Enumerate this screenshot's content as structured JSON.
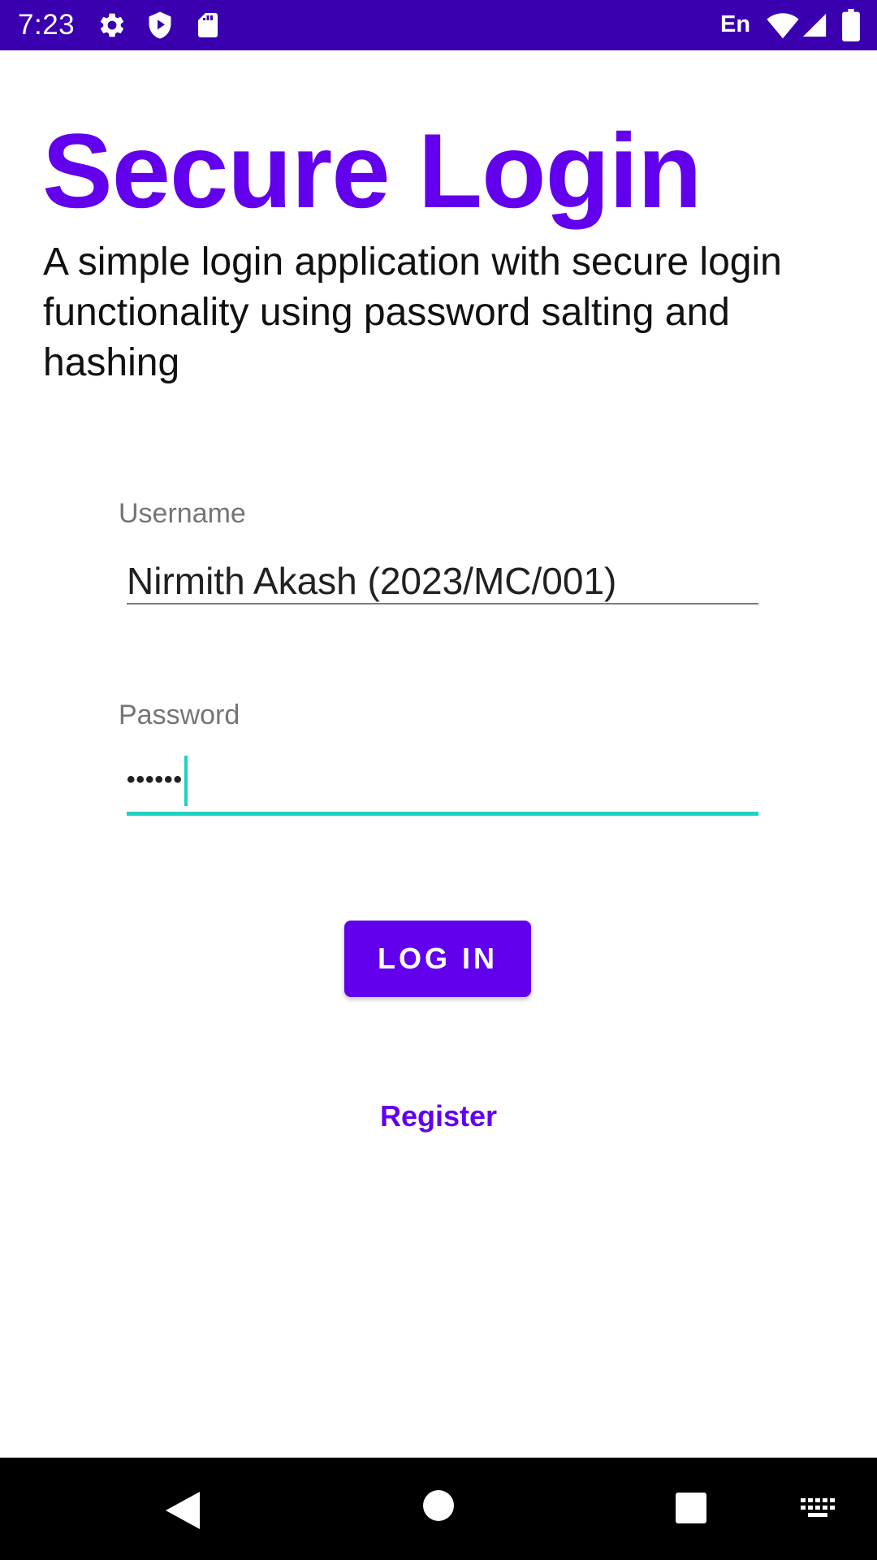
{
  "status_bar": {
    "time": "7:23",
    "language": "En",
    "icons": [
      "settings-icon",
      "shield-play-icon",
      "sd-card-icon",
      "wifi-icon",
      "cellular-signal-icon",
      "battery-icon"
    ]
  },
  "login": {
    "title": "Secure Login",
    "description": "A simple login application with secure login functionality using password salting and hashing",
    "username_label": "Username",
    "username_value": "Nirmith Akash (2023/MC/001)",
    "password_label": "Password",
    "password_value": "••••••",
    "login_button": "LOG IN",
    "register_link": "Register"
  },
  "nav_bar": {
    "icons": [
      "back-icon",
      "home-icon",
      "recents-icon",
      "keyboard-icon"
    ]
  },
  "colors": {
    "status_bar": "#3a00b0",
    "primary": "#6200ee",
    "focus_accent": "#1fd1c2",
    "label_gray": "#757575",
    "nav_bar": "#000000"
  }
}
